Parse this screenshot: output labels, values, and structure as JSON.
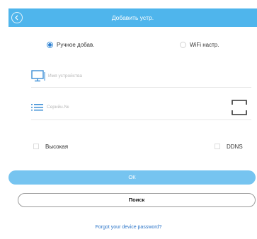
{
  "header": {
    "title": "Добавить устр."
  },
  "mode": {
    "manual_label": "Ручное добав.",
    "wifi_label": "WiFi настр.",
    "selected": "manual"
  },
  "fields": {
    "device_name_placeholder": "Имя устройства",
    "serial_placeholder": "Серийн.№"
  },
  "options": {
    "high_label": "Высокая",
    "ddns_label": "DDNS"
  },
  "actions": {
    "ok_label": "ОК",
    "search_label": "Поиск",
    "forgot_label": "Forgot your device password?"
  },
  "colors": {
    "accent": "#4fb5ec",
    "ok_button": "#76c4f0",
    "link": "#2a74c8"
  },
  "icons": {
    "back": "chevron-left-icon",
    "device": "monitor-icon",
    "serial": "list-icon",
    "scan": "scan-qr-icon"
  }
}
